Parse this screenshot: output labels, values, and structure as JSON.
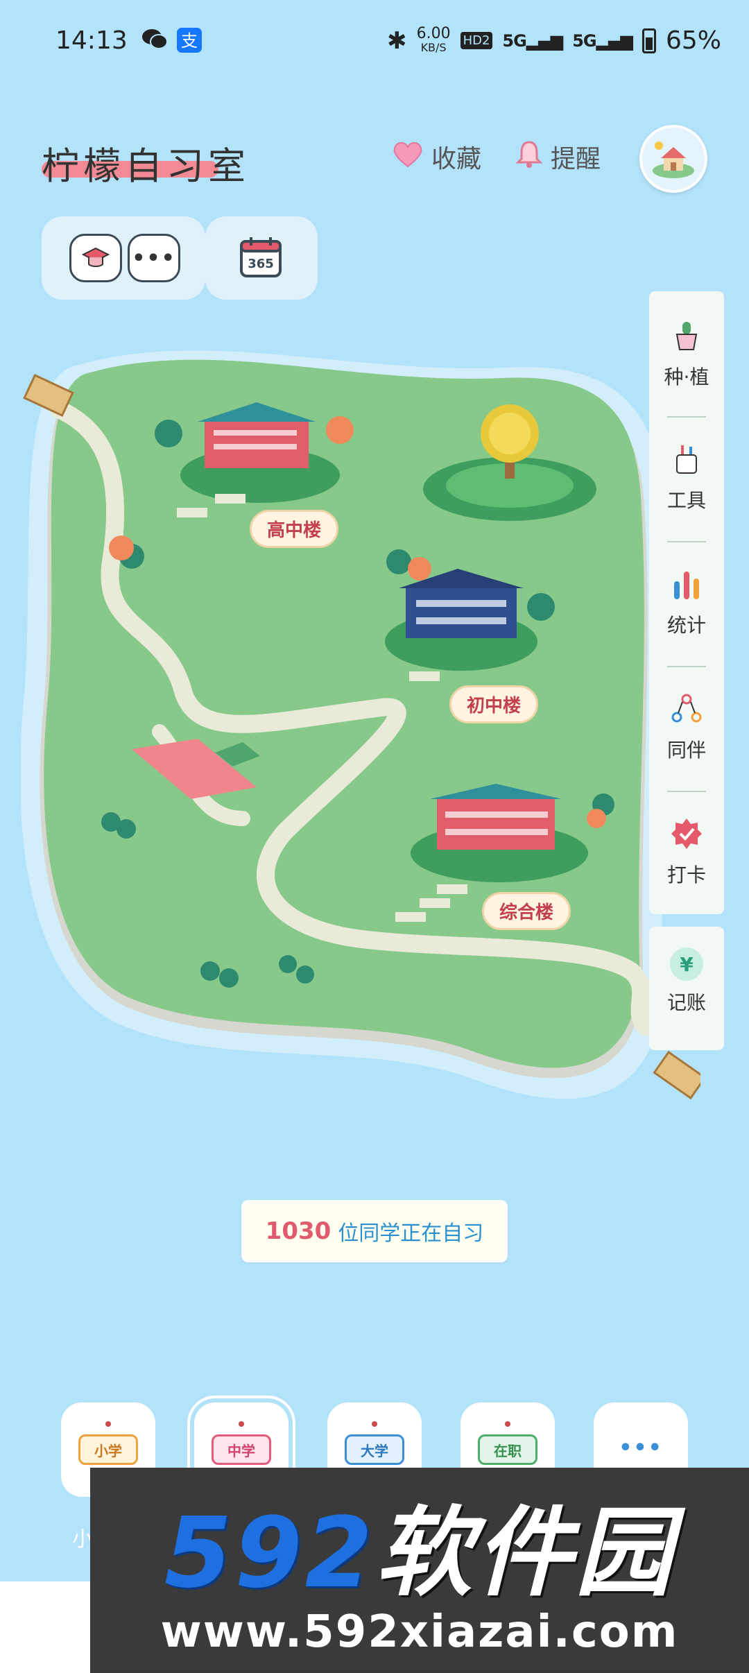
{
  "status_bar": {
    "time": "14:13",
    "net_speed": "6.00",
    "net_unit": "KB/S",
    "hd": "HD2",
    "sig1": "5G",
    "sig2": "5G",
    "battery": "65%"
  },
  "header": {
    "title": "柠檬自习室",
    "favorite_label": "收藏",
    "reminder_label": "提醒"
  },
  "toolbar": {
    "calendar_badge": "365"
  },
  "side_panel": {
    "items": [
      {
        "label": "种·植"
      },
      {
        "label": "工具"
      },
      {
        "label": "统计"
      },
      {
        "label": "同伴"
      },
      {
        "label": "打卡"
      }
    ],
    "ledger": {
      "label": "记账",
      "symbol": "¥"
    }
  },
  "map": {
    "buildings": [
      {
        "label": "高中楼"
      },
      {
        "label": "初中楼"
      },
      {
        "label": "综合楼"
      }
    ]
  },
  "counter": {
    "count": "1030",
    "text": "位同学正在自习"
  },
  "bottom_nav": {
    "items": [
      {
        "sign": "小学",
        "color": "#f2a23c"
      },
      {
        "sign": "中学",
        "color": "#e45a7a"
      },
      {
        "sign": "大学",
        "color": "#3a8fd8"
      },
      {
        "sign": "在职",
        "color": "#4caf6a"
      },
      {
        "sign": "•••"
      }
    ],
    "partial_label": "小"
  },
  "watermark": {
    "number": "592",
    "cn": "软件园",
    "url": "www.592xiazai.com"
  },
  "colors": {
    "background": "#b3e3fa",
    "island": "#86c98a",
    "accent_pink": "#f28a94",
    "counter_number": "#e05a6e",
    "counter_text": "#2a8fcf"
  }
}
